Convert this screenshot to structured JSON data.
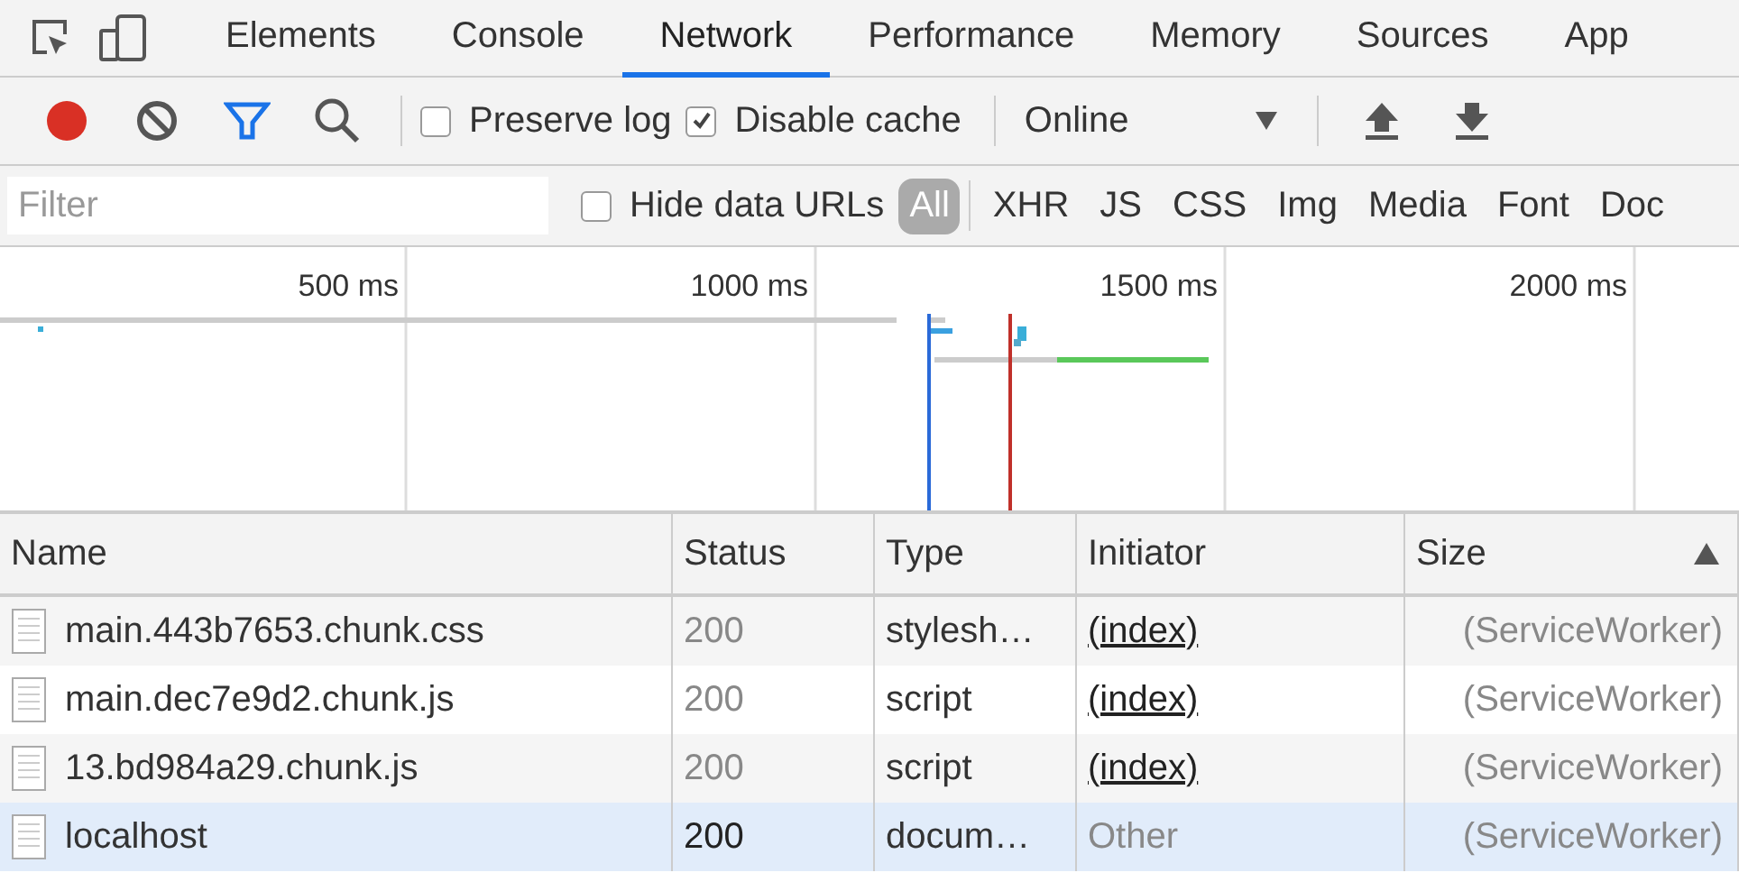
{
  "tabs": [
    {
      "label": "Elements",
      "selected": false
    },
    {
      "label": "Console",
      "selected": false
    },
    {
      "label": "Network",
      "selected": true
    },
    {
      "label": "Performance",
      "selected": false
    },
    {
      "label": "Memory",
      "selected": false
    },
    {
      "label": "Sources",
      "selected": false
    },
    {
      "label": "App",
      "selected": false
    }
  ],
  "toolbar": {
    "recording": true,
    "filter_active": true,
    "preserve_log": {
      "label": "Preserve log",
      "checked": false
    },
    "disable_cache": {
      "label": "Disable cache",
      "checked": true
    },
    "throttling": "Online"
  },
  "filter_bar": {
    "placeholder": "Filter",
    "hide_data_urls": {
      "label": "Hide data URLs",
      "checked": false
    },
    "types": [
      {
        "label": "All",
        "selected": true
      },
      {
        "label": "XHR",
        "selected": false
      },
      {
        "label": "JS",
        "selected": false
      },
      {
        "label": "CSS",
        "selected": false
      },
      {
        "label": "Img",
        "selected": false
      },
      {
        "label": "Media",
        "selected": false
      },
      {
        "label": "Font",
        "selected": false
      },
      {
        "label": "Doc",
        "selected": false
      }
    ]
  },
  "timeline": {
    "ticks": [
      "500 ms",
      "1000 ms",
      "1500 ms",
      "2000 ms"
    ]
  },
  "table": {
    "columns": [
      "Name",
      "Status",
      "Type",
      "Initiator",
      "Size"
    ],
    "rows": [
      {
        "name": "main.443b7653.chunk.css",
        "status": "200",
        "type": "stylesh…",
        "initiator": "(index)",
        "underlined": true,
        "size": "(ServiceWorker)",
        "selected": false
      },
      {
        "name": "main.dec7e9d2.chunk.js",
        "status": "200",
        "type": "script",
        "initiator": "(index)",
        "underlined": true,
        "size": "(ServiceWorker)",
        "selected": false
      },
      {
        "name": "13.bd984a29.chunk.js",
        "status": "200",
        "type": "script",
        "initiator": "(index)",
        "underlined": true,
        "size": "(ServiceWorker)",
        "selected": false
      },
      {
        "name": "localhost",
        "status": "200",
        "type": "docum…",
        "initiator": "Other",
        "underlined": false,
        "size": "(ServiceWorker)",
        "selected": true
      }
    ]
  }
}
